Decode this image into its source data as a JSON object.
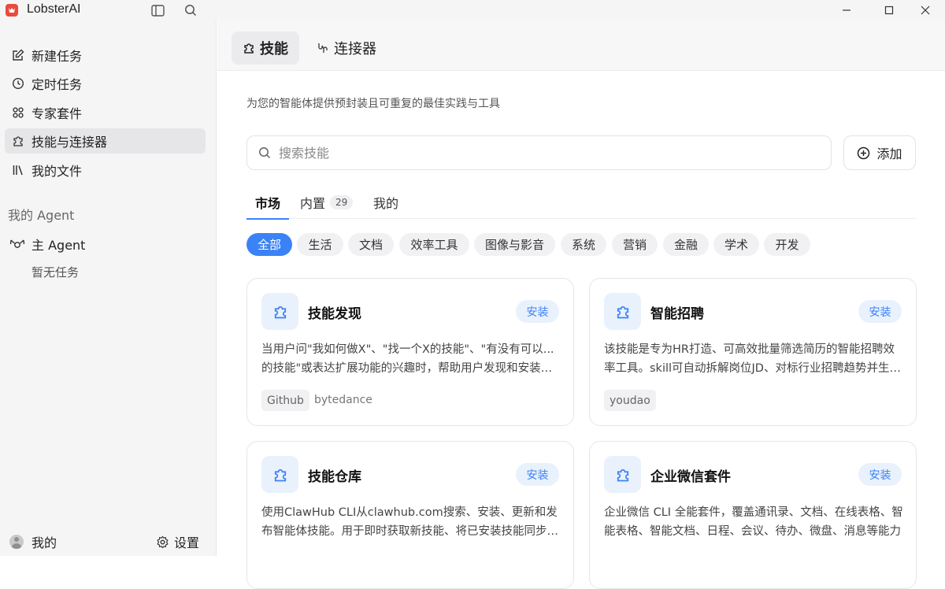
{
  "app": {
    "title": "LobsterAI"
  },
  "sidebar": {
    "items": [
      {
        "label": "新建任务",
        "icon": "edit-icon"
      },
      {
        "label": "定时任务",
        "icon": "clock-icon"
      },
      {
        "label": "专家套件",
        "icon": "grid-icon"
      },
      {
        "label": "技能与连接器",
        "icon": "puzzle-icon"
      },
      {
        "label": "我的文件",
        "icon": "files-icon"
      }
    ],
    "agent_section_title": "我的 Agent",
    "agent_name": "主 Agent",
    "empty_tasks": "暂无任务",
    "me_label": "我的",
    "settings_label": "设置"
  },
  "topbar": {
    "tabs": [
      {
        "label": "技能",
        "active": true
      },
      {
        "label": "连接器",
        "active": false
      }
    ]
  },
  "main": {
    "subtitle": "为您的智能体提供预封装且可重复的最佳实践与工具",
    "search_placeholder": "搜索技能",
    "add_label": "添加",
    "sub_tabs": [
      {
        "label": "市场",
        "active": true
      },
      {
        "label": "内置",
        "count": "29"
      },
      {
        "label": "我的"
      }
    ],
    "filters": [
      "全部",
      "生活",
      "文档",
      "效率工具",
      "图像与影音",
      "系统",
      "营销",
      "金融",
      "学术",
      "开发"
    ],
    "active_filter": "全部",
    "install_label": "安装",
    "cards": [
      {
        "title": "技能发现",
        "description": "当用户问\"我如何做X\"、\"找一个X的技能\"、\"有没有可以...的技能\"或表达扩展功能的兴趣时，帮助用户发现和安装技能",
        "tag": "Github",
        "author": "bytedance"
      },
      {
        "title": "智能招聘",
        "description": "该技能是专为HR打造、可高效批量筛选简历的智能招聘效率工具。skill可自动拆解岗位JD、对标行业招聘趋势并生成评估标准",
        "tag": "youdao",
        "author": ""
      },
      {
        "title": "技能仓库",
        "description": "使用ClawHub CLI从clawhub.com搜索、安装、更新和发布智能体技能。用于即时获取新技能、将已安装技能同步到最新版本",
        "tag": "",
        "author": ""
      },
      {
        "title": "企业微信套件",
        "description": "企业微信 CLI 全能套件，覆盖通讯录、文档、在线表格、智能表格、智能文档、日程、会议、待办、微盘、消息等能力",
        "tag": "",
        "author": ""
      }
    ]
  },
  "colors": {
    "accent": "#3b82f6",
    "install_bg": "#e9f1fd",
    "brand": "#ea4a3c"
  }
}
